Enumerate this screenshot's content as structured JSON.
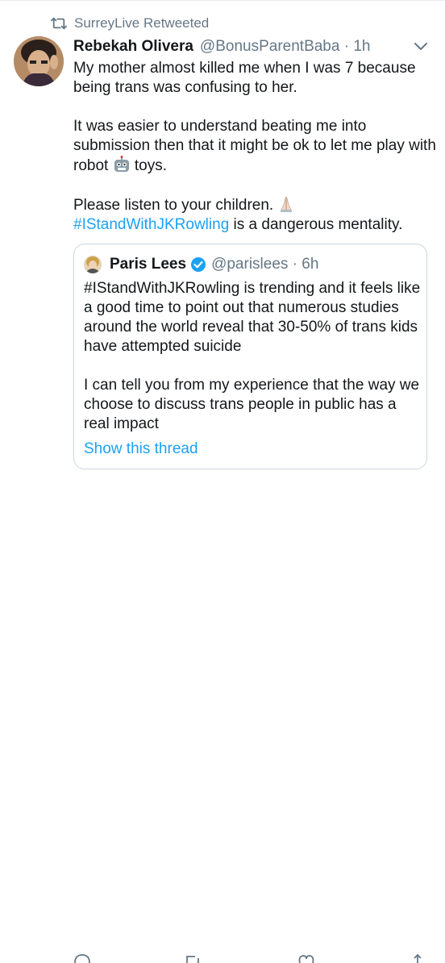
{
  "retweet": {
    "label": "SurreyLive Retweeted",
    "icon": "retweet-icon"
  },
  "tweet": {
    "author_name": "Rebekah Olivera",
    "author_meta": "@BonusParentBaba · 1h",
    "menu_icon": "chevron-down-icon",
    "paragraphs": {
      "p1": "My mother almost killed me when I was 7 because being trans was confusing to her.",
      "p2_a": "It was easier to understand beating me into submission then that it might be ok to let me play with robot",
      "p2_b": "toys.",
      "p3_a": "Please listen to your children.",
      "p3_hashtag": "#IStandWithJKRowling",
      "p3_b": "is a dangerous mentality."
    },
    "emojis": [
      "robot-emoji",
      "praying-hands-emoji"
    ]
  },
  "quote": {
    "author_name": "Paris Lees",
    "verified_icon": "verified-badge-icon",
    "author_meta": "@parislees · 6h",
    "paragraph1": "#IStandWithJKRowling is trending and it feels like a good time to point out that numerous studies around the world reveal that 30-50% of trans kids have attempted suicide",
    "paragraph2": "I can tell you from my experience that the way we choose to discuss trans people in public has a real impact",
    "show_thread": "Show this thread"
  },
  "colors": {
    "link": "#1da1f2",
    "muted": "#657786",
    "text": "#14171a",
    "border": "#ccd6dd"
  }
}
